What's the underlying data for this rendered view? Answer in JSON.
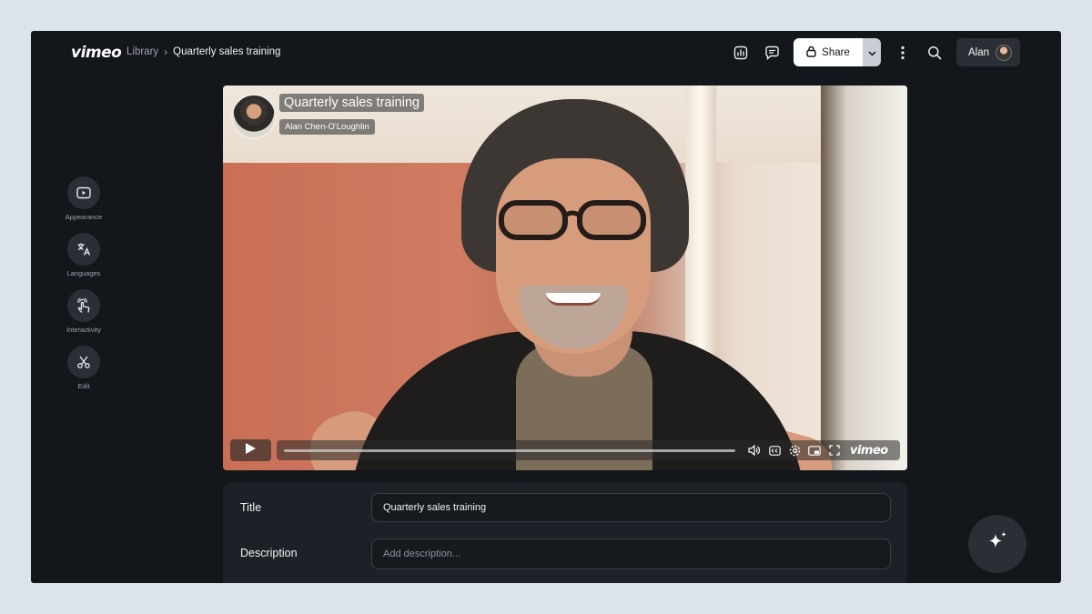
{
  "header": {
    "logo": "vimeo",
    "breadcrumb": {
      "root": "Library",
      "separator": "›",
      "current": "Quarterly sales training"
    },
    "icons": [
      "analytics-icon",
      "comments-icon",
      "more-icon",
      "search-icon"
    ],
    "share_label": "Share",
    "user_name": "Alan"
  },
  "sidebar": {
    "items": [
      {
        "label": "Appearance",
        "icon": "play-screen-icon"
      },
      {
        "label": "Languages",
        "icon": "translate-icon"
      },
      {
        "label": "Interactivity",
        "icon": "tap-icon"
      },
      {
        "label": "Edit",
        "icon": "scissors-icon"
      }
    ]
  },
  "video": {
    "title": "Quarterly sales training",
    "author": "Alan Chen-O'Loughlin",
    "progress": 0.0,
    "player_logo": "vimeo"
  },
  "details": {
    "title_label": "Title",
    "title_value": "Quarterly sales training",
    "description_label": "Description",
    "description_placeholder": "Add description..."
  },
  "colors": {
    "background": "#dde3ea",
    "app": "#13161b",
    "panel": "#1d2127",
    "accent": "#ffffff"
  }
}
